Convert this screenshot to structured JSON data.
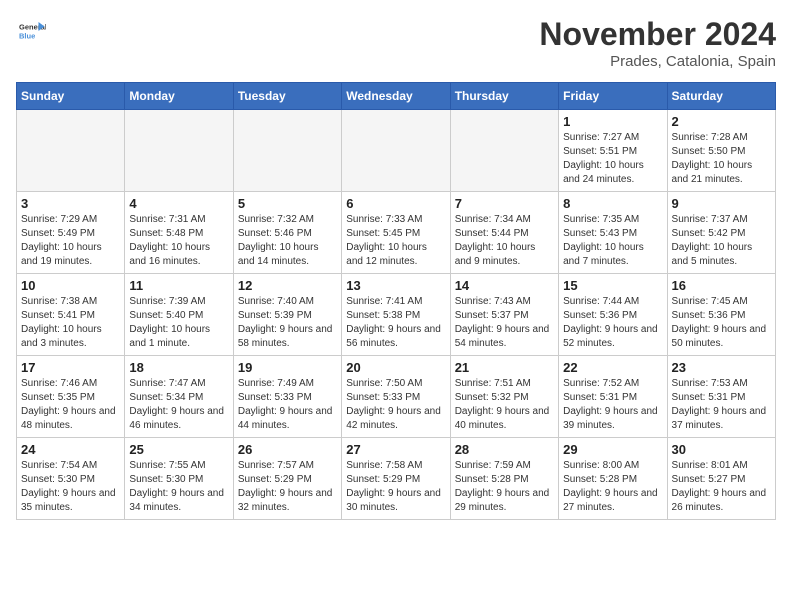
{
  "header": {
    "logo_general": "General",
    "logo_blue": "Blue",
    "month_title": "November 2024",
    "location": "Prades, Catalonia, Spain"
  },
  "days_of_week": [
    "Sunday",
    "Monday",
    "Tuesday",
    "Wednesday",
    "Thursday",
    "Friday",
    "Saturday"
  ],
  "weeks": [
    [
      {
        "day": "",
        "empty": true
      },
      {
        "day": "",
        "empty": true
      },
      {
        "day": "",
        "empty": true
      },
      {
        "day": "",
        "empty": true
      },
      {
        "day": "",
        "empty": true
      },
      {
        "day": "1",
        "sunrise": "Sunrise: 7:27 AM",
        "sunset": "Sunset: 5:51 PM",
        "daylight": "Daylight: 10 hours and 24 minutes."
      },
      {
        "day": "2",
        "sunrise": "Sunrise: 7:28 AM",
        "sunset": "Sunset: 5:50 PM",
        "daylight": "Daylight: 10 hours and 21 minutes."
      }
    ],
    [
      {
        "day": "3",
        "sunrise": "Sunrise: 7:29 AM",
        "sunset": "Sunset: 5:49 PM",
        "daylight": "Daylight: 10 hours and 19 minutes."
      },
      {
        "day": "4",
        "sunrise": "Sunrise: 7:31 AM",
        "sunset": "Sunset: 5:48 PM",
        "daylight": "Daylight: 10 hours and 16 minutes."
      },
      {
        "day": "5",
        "sunrise": "Sunrise: 7:32 AM",
        "sunset": "Sunset: 5:46 PM",
        "daylight": "Daylight: 10 hours and 14 minutes."
      },
      {
        "day": "6",
        "sunrise": "Sunrise: 7:33 AM",
        "sunset": "Sunset: 5:45 PM",
        "daylight": "Daylight: 10 hours and 12 minutes."
      },
      {
        "day": "7",
        "sunrise": "Sunrise: 7:34 AM",
        "sunset": "Sunset: 5:44 PM",
        "daylight": "Daylight: 10 hours and 9 minutes."
      },
      {
        "day": "8",
        "sunrise": "Sunrise: 7:35 AM",
        "sunset": "Sunset: 5:43 PM",
        "daylight": "Daylight: 10 hours and 7 minutes."
      },
      {
        "day": "9",
        "sunrise": "Sunrise: 7:37 AM",
        "sunset": "Sunset: 5:42 PM",
        "daylight": "Daylight: 10 hours and 5 minutes."
      }
    ],
    [
      {
        "day": "10",
        "sunrise": "Sunrise: 7:38 AM",
        "sunset": "Sunset: 5:41 PM",
        "daylight": "Daylight: 10 hours and 3 minutes."
      },
      {
        "day": "11",
        "sunrise": "Sunrise: 7:39 AM",
        "sunset": "Sunset: 5:40 PM",
        "daylight": "Daylight: 10 hours and 1 minute."
      },
      {
        "day": "12",
        "sunrise": "Sunrise: 7:40 AM",
        "sunset": "Sunset: 5:39 PM",
        "daylight": "Daylight: 9 hours and 58 minutes."
      },
      {
        "day": "13",
        "sunrise": "Sunrise: 7:41 AM",
        "sunset": "Sunset: 5:38 PM",
        "daylight": "Daylight: 9 hours and 56 minutes."
      },
      {
        "day": "14",
        "sunrise": "Sunrise: 7:43 AM",
        "sunset": "Sunset: 5:37 PM",
        "daylight": "Daylight: 9 hours and 54 minutes."
      },
      {
        "day": "15",
        "sunrise": "Sunrise: 7:44 AM",
        "sunset": "Sunset: 5:36 PM",
        "daylight": "Daylight: 9 hours and 52 minutes."
      },
      {
        "day": "16",
        "sunrise": "Sunrise: 7:45 AM",
        "sunset": "Sunset: 5:36 PM",
        "daylight": "Daylight: 9 hours and 50 minutes."
      }
    ],
    [
      {
        "day": "17",
        "sunrise": "Sunrise: 7:46 AM",
        "sunset": "Sunset: 5:35 PM",
        "daylight": "Daylight: 9 hours and 48 minutes."
      },
      {
        "day": "18",
        "sunrise": "Sunrise: 7:47 AM",
        "sunset": "Sunset: 5:34 PM",
        "daylight": "Daylight: 9 hours and 46 minutes."
      },
      {
        "day": "19",
        "sunrise": "Sunrise: 7:49 AM",
        "sunset": "Sunset: 5:33 PM",
        "daylight": "Daylight: 9 hours and 44 minutes."
      },
      {
        "day": "20",
        "sunrise": "Sunrise: 7:50 AM",
        "sunset": "Sunset: 5:33 PM",
        "daylight": "Daylight: 9 hours and 42 minutes."
      },
      {
        "day": "21",
        "sunrise": "Sunrise: 7:51 AM",
        "sunset": "Sunset: 5:32 PM",
        "daylight": "Daylight: 9 hours and 40 minutes."
      },
      {
        "day": "22",
        "sunrise": "Sunrise: 7:52 AM",
        "sunset": "Sunset: 5:31 PM",
        "daylight": "Daylight: 9 hours and 39 minutes."
      },
      {
        "day": "23",
        "sunrise": "Sunrise: 7:53 AM",
        "sunset": "Sunset: 5:31 PM",
        "daylight": "Daylight: 9 hours and 37 minutes."
      }
    ],
    [
      {
        "day": "24",
        "sunrise": "Sunrise: 7:54 AM",
        "sunset": "Sunset: 5:30 PM",
        "daylight": "Daylight: 9 hours and 35 minutes."
      },
      {
        "day": "25",
        "sunrise": "Sunrise: 7:55 AM",
        "sunset": "Sunset: 5:30 PM",
        "daylight": "Daylight: 9 hours and 34 minutes."
      },
      {
        "day": "26",
        "sunrise": "Sunrise: 7:57 AM",
        "sunset": "Sunset: 5:29 PM",
        "daylight": "Daylight: 9 hours and 32 minutes."
      },
      {
        "day": "27",
        "sunrise": "Sunrise: 7:58 AM",
        "sunset": "Sunset: 5:29 PM",
        "daylight": "Daylight: 9 hours and 30 minutes."
      },
      {
        "day": "28",
        "sunrise": "Sunrise: 7:59 AM",
        "sunset": "Sunset: 5:28 PM",
        "daylight": "Daylight: 9 hours and 29 minutes."
      },
      {
        "day": "29",
        "sunrise": "Sunrise: 8:00 AM",
        "sunset": "Sunset: 5:28 PM",
        "daylight": "Daylight: 9 hours and 27 minutes."
      },
      {
        "day": "30",
        "sunrise": "Sunrise: 8:01 AM",
        "sunset": "Sunset: 5:27 PM",
        "daylight": "Daylight: 9 hours and 26 minutes."
      }
    ]
  ]
}
